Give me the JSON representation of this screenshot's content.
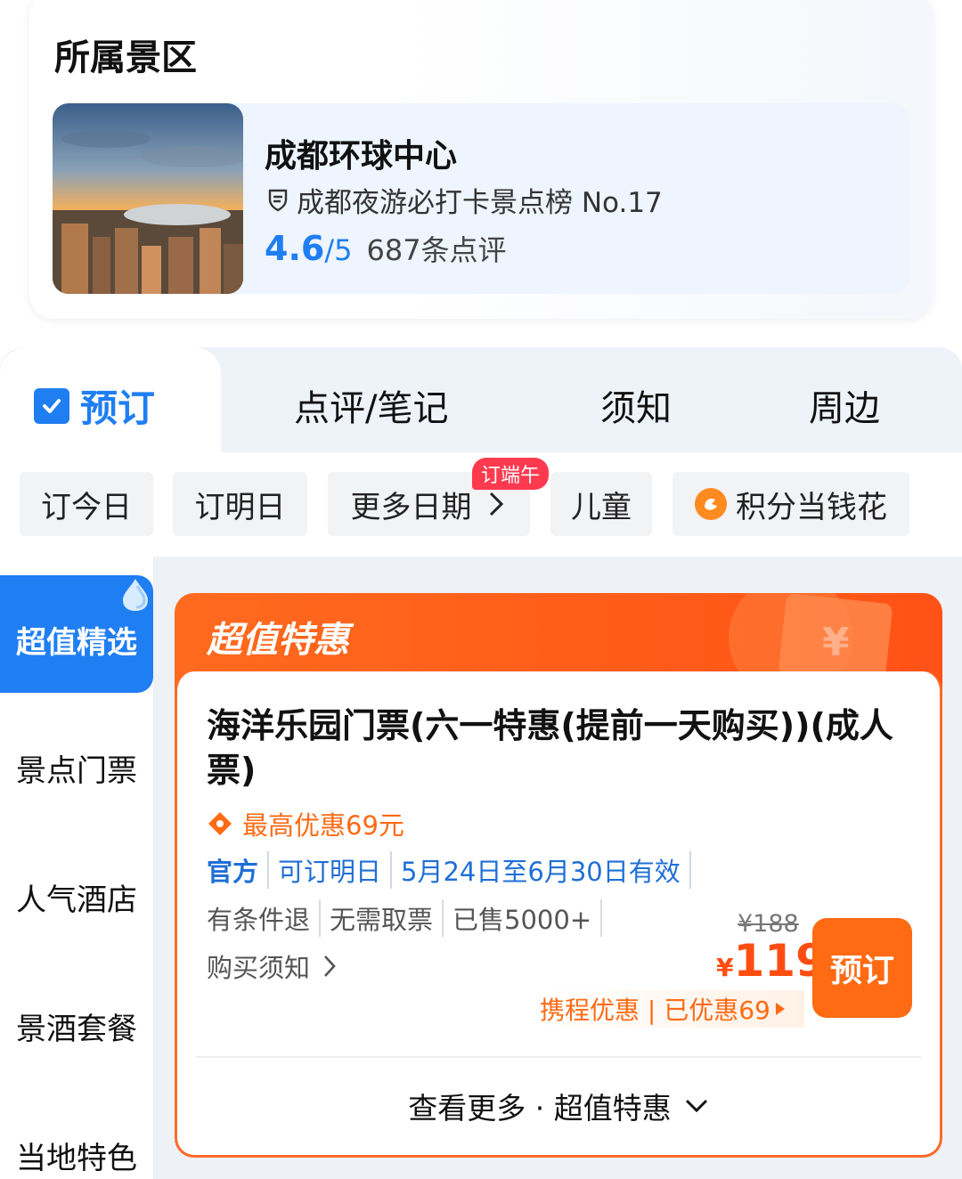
{
  "scenic": {
    "section_title": "所属景区",
    "name": "成都环球中心",
    "ranking": "成都夜游必打卡景点榜 No.17",
    "score": "4.6",
    "score_max": "/5",
    "reviews": "687条点评"
  },
  "tabs": [
    {
      "label": "预订",
      "active": true
    },
    {
      "label": "点评/笔记"
    },
    {
      "label": "须知"
    },
    {
      "label": "周边"
    }
  ],
  "chips": {
    "today": "订今日",
    "tomorrow": "订明日",
    "more_dates": "更多日期",
    "badge": "订端午",
    "children": "儿童",
    "points": "积分当钱花"
  },
  "sidebar": {
    "items": [
      "超值精选",
      "景点门票",
      "人气酒店",
      "景酒套餐",
      "当地特色"
    ]
  },
  "deal": {
    "header": "超值特惠",
    "title": "海洋乐园门票(六一特惠(提前一天购买))(成人票)",
    "discount": "最高优惠69元",
    "tags": [
      "官方",
      "可订明日",
      "5月24日至6月30日有效"
    ],
    "tags2": [
      "有条件退",
      "无需取票",
      "已售5000+"
    ],
    "notice": "购买须知",
    "old_price": "¥188",
    "currency": "¥",
    "price": "119",
    "book": "预订",
    "promo": "携程优惠 | 已优惠69",
    "more": "查看更多 · 超值特惠"
  },
  "colors": {
    "accent": "#1f7ef2",
    "deal_orange": "#ff6a12",
    "badge_red": "#ff3a4f"
  }
}
